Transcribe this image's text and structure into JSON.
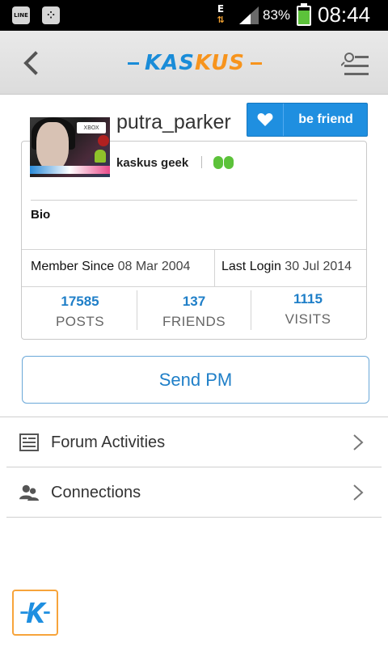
{
  "status_bar": {
    "line_icon": "LINE",
    "network_type": "E",
    "battery_percent": "83%",
    "battery_level": 0.83,
    "time": "08:44"
  },
  "header": {
    "logo_left": "KAS",
    "logo_right": "KUS",
    "back_icon": "chevron-left-icon",
    "menu_icon": "search-menu-icon"
  },
  "profile": {
    "username": "putra_parker",
    "befriend_label": "be friend",
    "rank": "kaskus geek",
    "bio_label": "Bio",
    "member_since_label": "Member Since",
    "member_since_value": "08 Mar 2004",
    "last_login_label": "Last Login",
    "last_login_value": "30 Jul 2014",
    "stats": [
      {
        "value": "17585",
        "label": "POSTS"
      },
      {
        "value": "137",
        "label": "FRIENDS"
      },
      {
        "value": "1115",
        "label": "VISITS"
      }
    ]
  },
  "actions": {
    "send_pm": "Send PM"
  },
  "menu": [
    {
      "label": "Forum Activities",
      "icon": "document-icon"
    },
    {
      "label": "Connections",
      "icon": "people-icon"
    }
  ],
  "colors": {
    "accent_blue": "#1f8fe0",
    "link_blue": "#1f7fc8",
    "brand_orange": "#f7941d",
    "reputation_green": "#5cc23a"
  }
}
